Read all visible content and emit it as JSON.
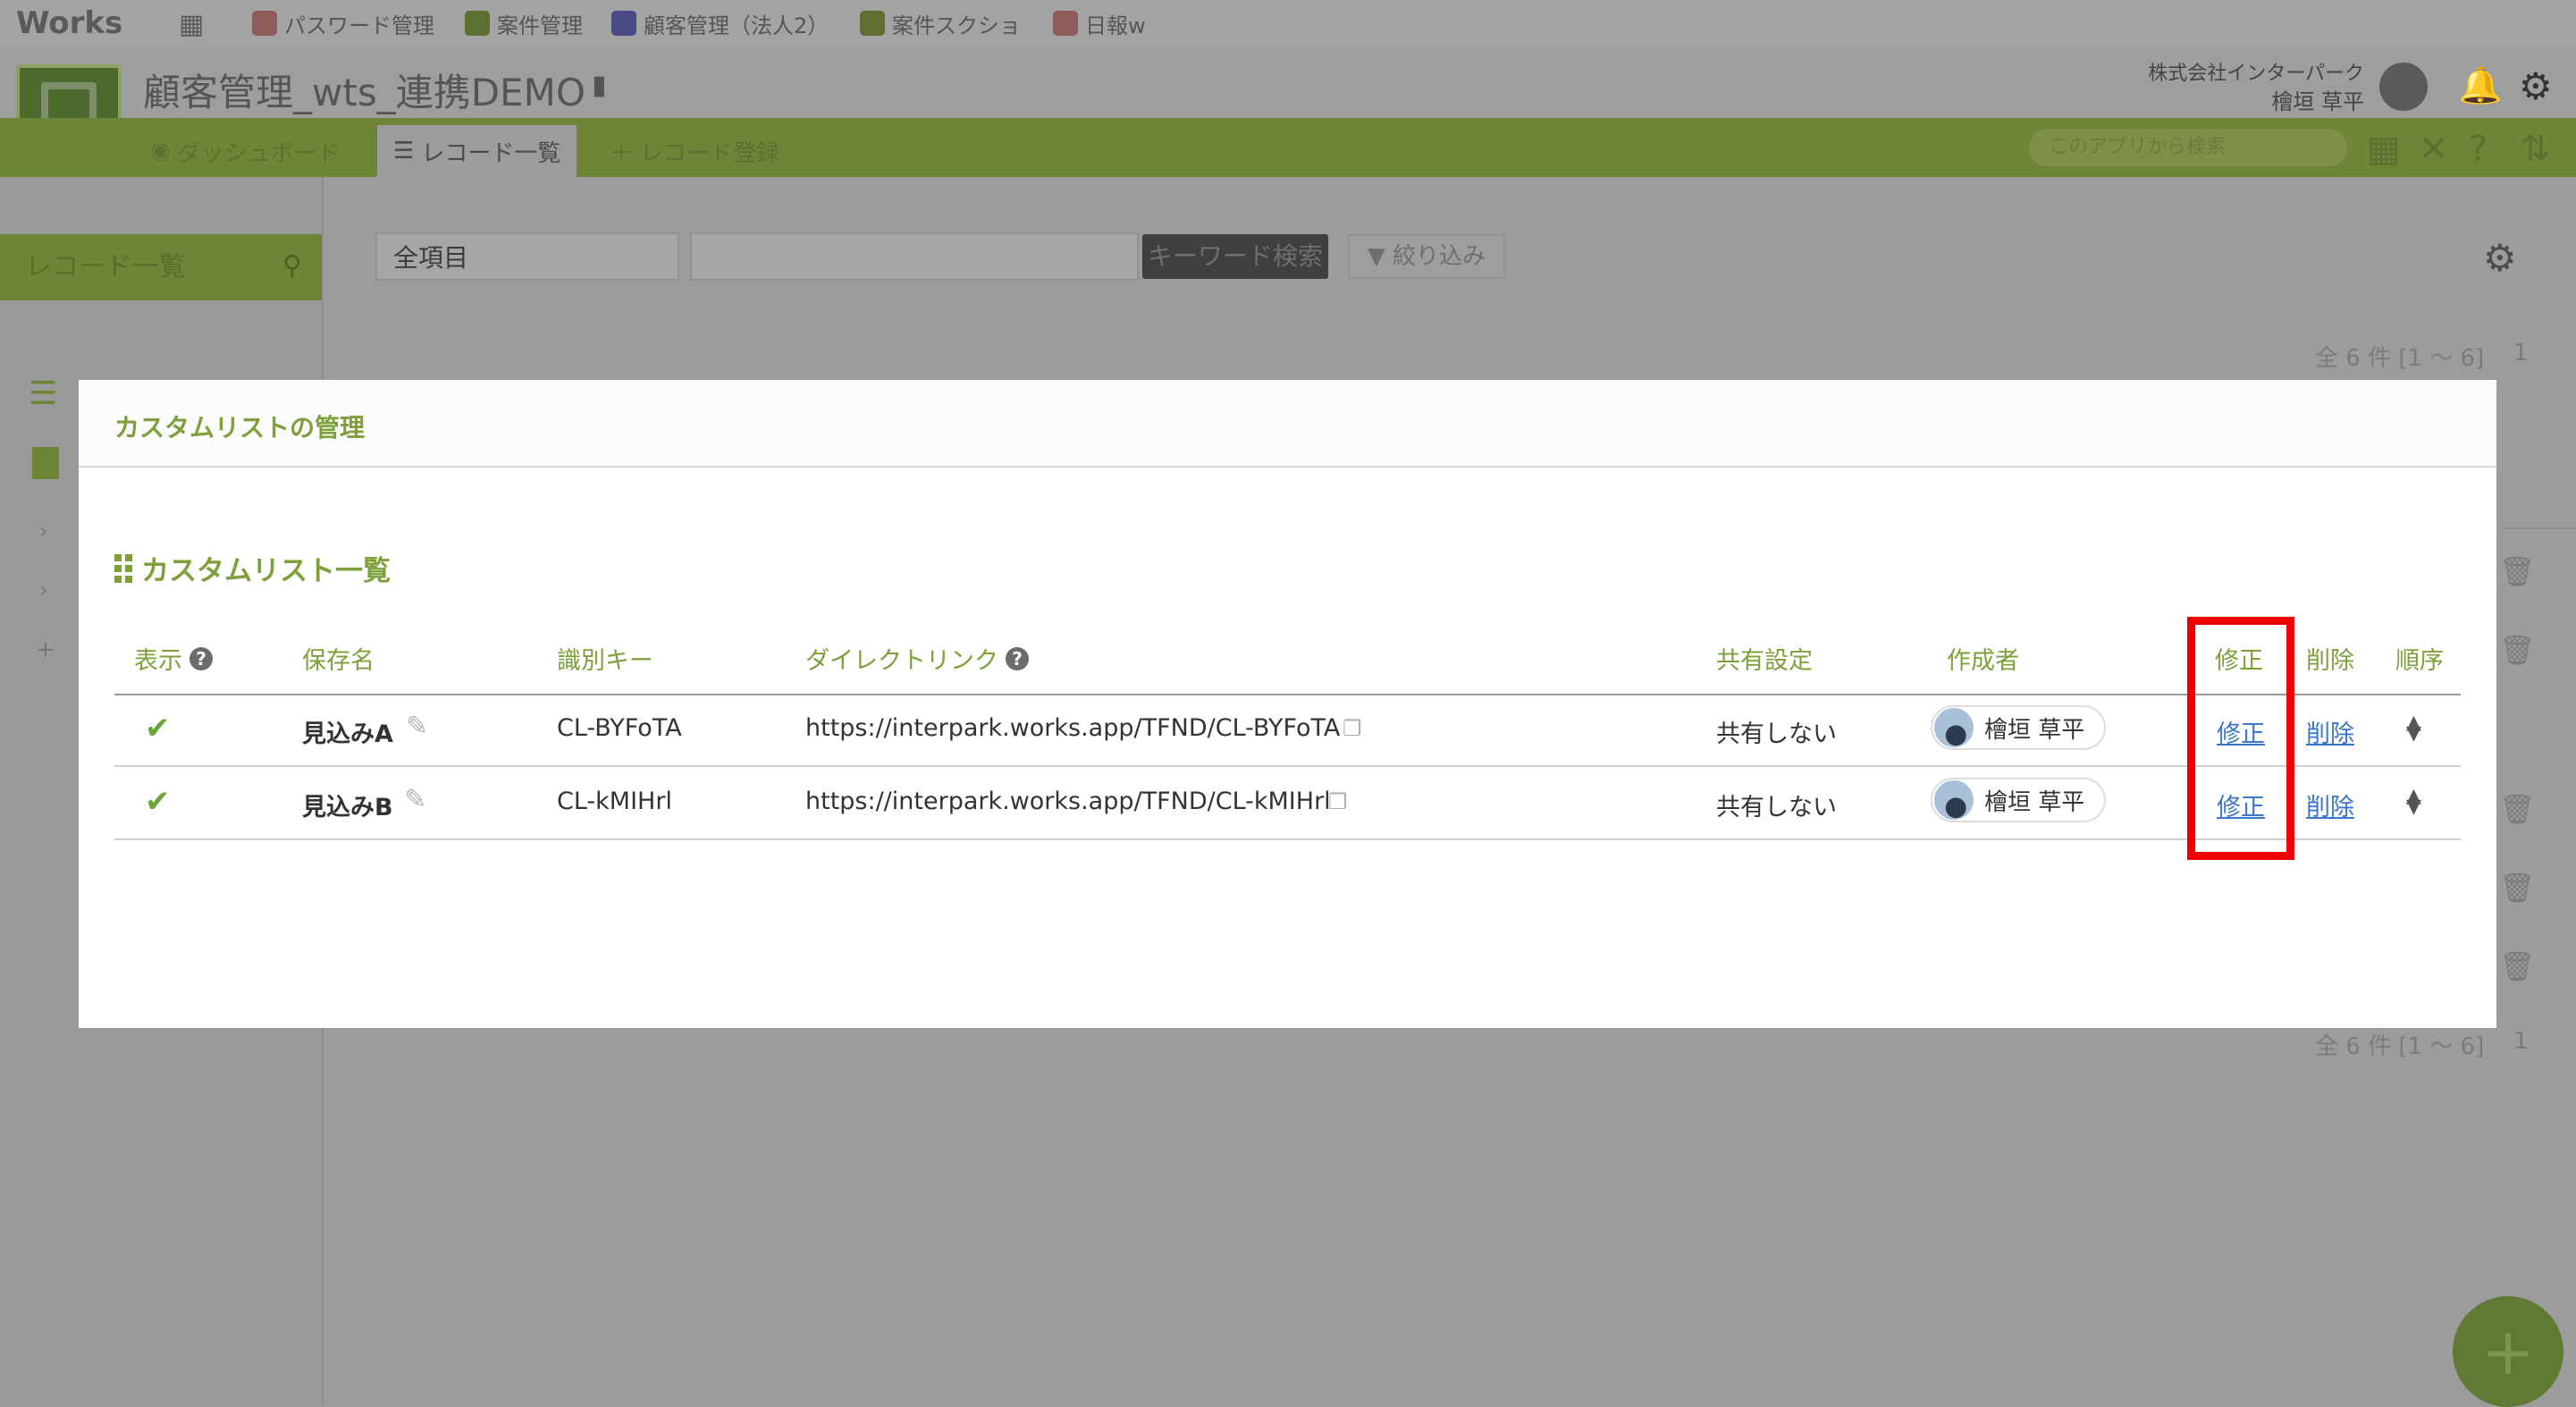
{
  "topbar": {
    "logo": "Works",
    "bookmarks": [
      {
        "label": "パスワード管理",
        "color": "#8f5a5a"
      },
      {
        "label": "案件管理",
        "color": "#5e7031"
      },
      {
        "label": "顧客管理（法人2）",
        "color": "#4a4a88"
      },
      {
        "label": "案件スクショ",
        "color": "#5e7031"
      },
      {
        "label": "日報w",
        "color": "#8f5a5a"
      }
    ]
  },
  "header": {
    "app_title": "顧客管理_wts_連携DEMO",
    "company": "株式会社インターパーク",
    "user": "檜垣 草平"
  },
  "nav": {
    "tabs": [
      "ダッシュボード",
      "レコード一覧",
      "レコード登録"
    ],
    "search_placeholder": "このアプリから検索"
  },
  "sidebar": {
    "title": "レコード一覧"
  },
  "toolbar": {
    "field_select": "全項目",
    "keyword_button": "キーワード検索",
    "filter_button": "絞り込み",
    "count_top": "全 6 件 [1 ～ 6]",
    "count_bottom": "全 6 件 [1 ～ 6]",
    "page": "1"
  },
  "modal": {
    "title": "カスタムリストの管理",
    "section_title": "カスタムリスト一覧",
    "columns": {
      "show": "表示",
      "name": "保存名",
      "key": "識別キー",
      "link": "ダイレクトリンク",
      "share": "共有設定",
      "creator": "作成者",
      "edit": "修正",
      "delete": "削除",
      "order": "順序"
    },
    "rows": [
      {
        "name": "見込みA",
        "key": "CL-BYFoTA",
        "link": "https://interpark.works.app/TFND/CL-BYFoTA",
        "share": "共有しない",
        "creator": "檜垣 草平",
        "edit": "修正",
        "delete": "削除"
      },
      {
        "name": "見込みB",
        "key": "CL-kMIHrl",
        "link": "https://interpark.works.app/TFND/CL-kMIHrl",
        "share": "共有しない",
        "creator": "檜垣 草平",
        "edit": "修正",
        "delete": "削除"
      }
    ]
  },
  "colors": {
    "accent": "#7da03a",
    "link": "#3a76c9",
    "highlight": "#ee0000"
  }
}
